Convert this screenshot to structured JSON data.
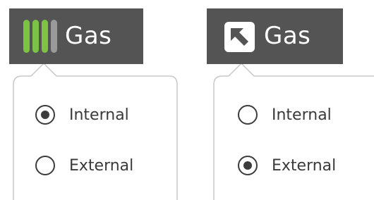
{
  "colors": {
    "header_bg": "#545454",
    "header_text": "#ffffff",
    "bar_active": "#7cc244",
    "bar_inactive": "#9a9a9a",
    "radio": "#3c3c3c",
    "popover_border": "#c8c8c8"
  },
  "panels": [
    {
      "header": {
        "icon": "signal-bars-icon",
        "label": "Gas",
        "bars": [
          "active",
          "active",
          "active",
          "inactive"
        ]
      },
      "options": [
        {
          "label": "Internal",
          "checked": true
        },
        {
          "label": "External",
          "checked": false
        }
      ]
    },
    {
      "header": {
        "icon": "arrow-up-left-icon",
        "label": "Gas"
      },
      "options": [
        {
          "label": "Internal",
          "checked": false
        },
        {
          "label": "External",
          "checked": true
        }
      ]
    }
  ]
}
